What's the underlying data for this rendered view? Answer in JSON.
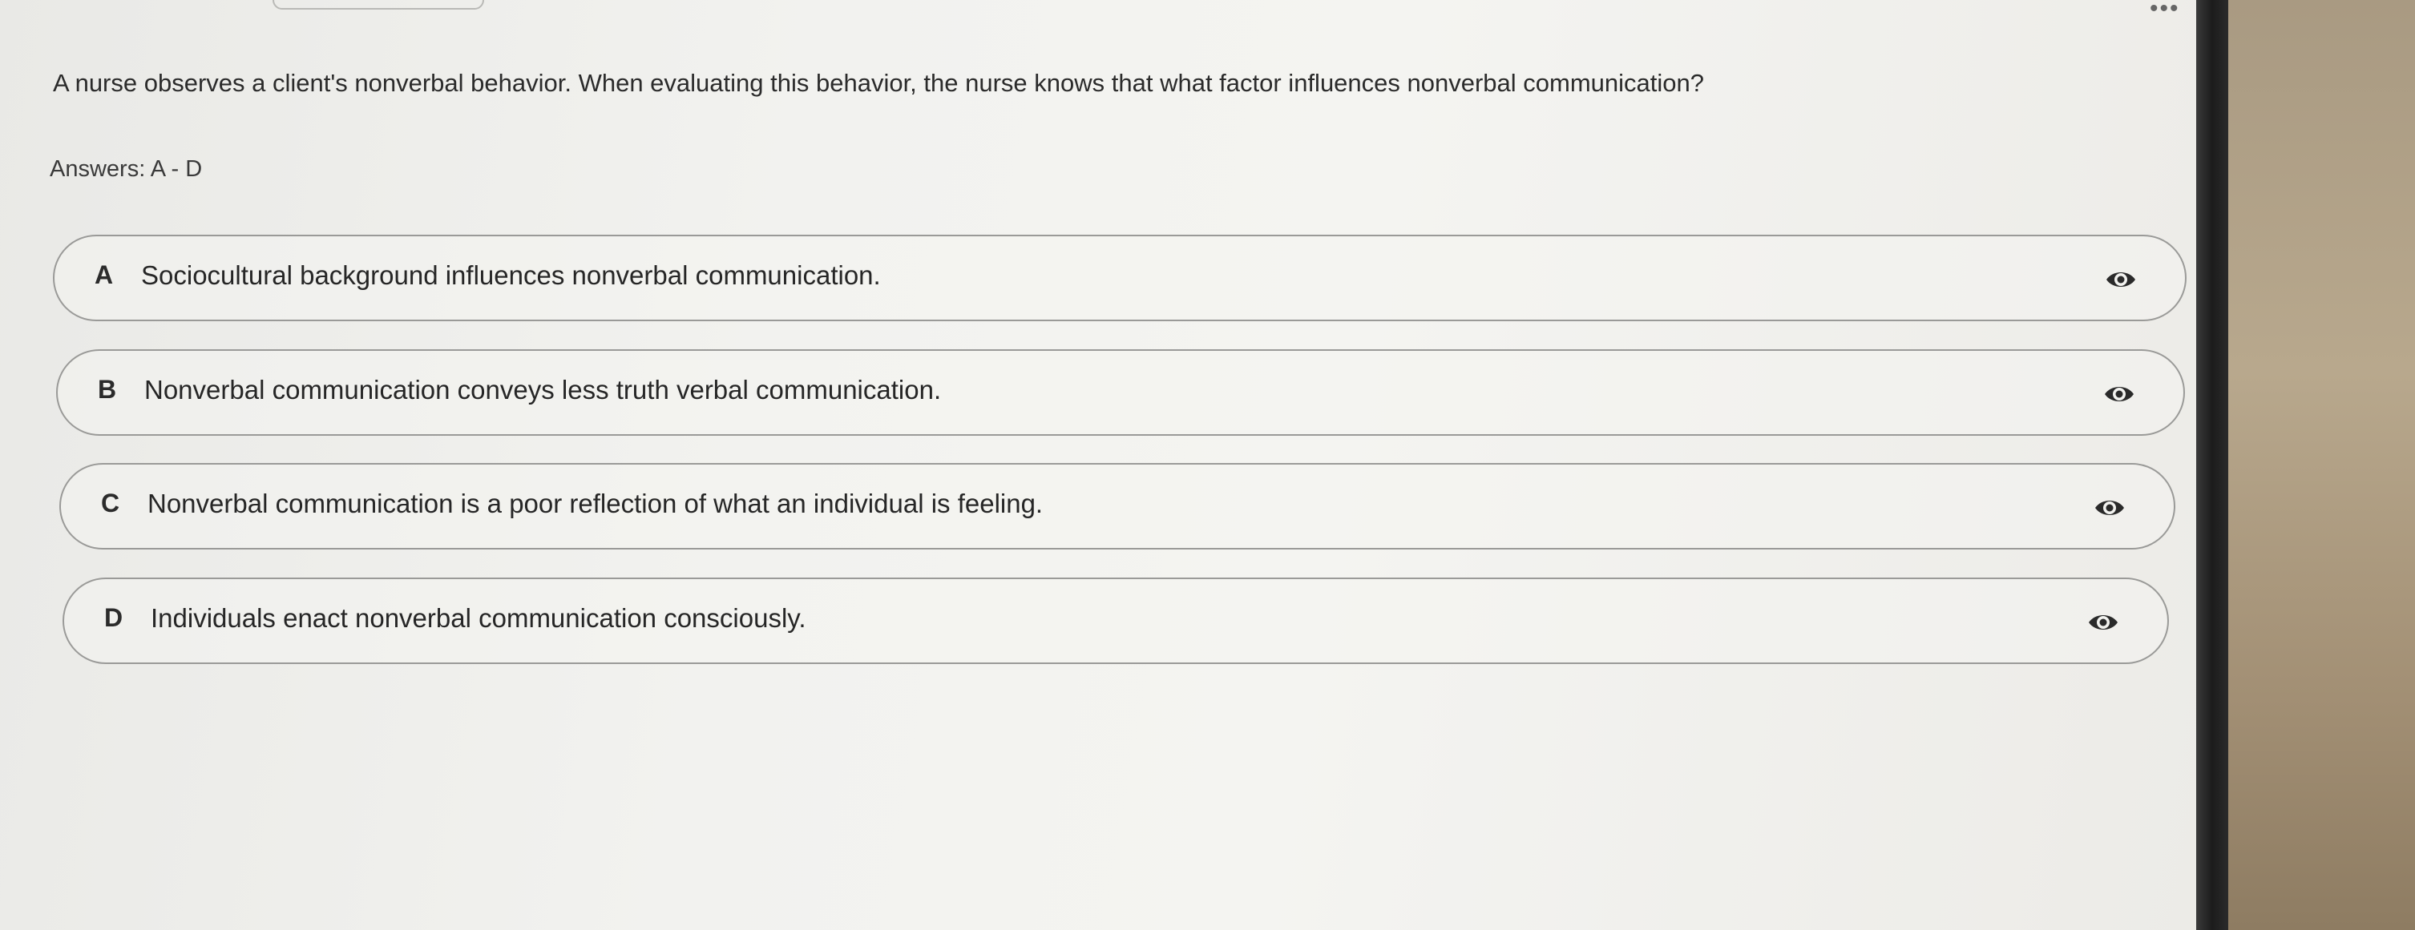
{
  "question": "A nurse observes a client's nonverbal behavior. When evaluating this behavior, the nurse knows that what factor influences nonverbal communication?",
  "answers_label": "Answers: A - D",
  "options": [
    {
      "letter": "A",
      "text": "Sociocultural background influences nonverbal communication.",
      "icon": "eye-icon"
    },
    {
      "letter": "B",
      "text": "Nonverbal communication conveys less truth verbal communication.",
      "icon": "eye-icon"
    },
    {
      "letter": "C",
      "text": "Nonverbal communication is a poor reflection of what an individual is feeling.",
      "icon": "eye-icon"
    },
    {
      "letter": "D",
      "text": "Individuals enact nonverbal communication consciously.",
      "icon": "eye-icon"
    }
  ],
  "colors": {
    "text": "#262626",
    "border": "#9a9a98",
    "background": "#f2f2ef"
  }
}
